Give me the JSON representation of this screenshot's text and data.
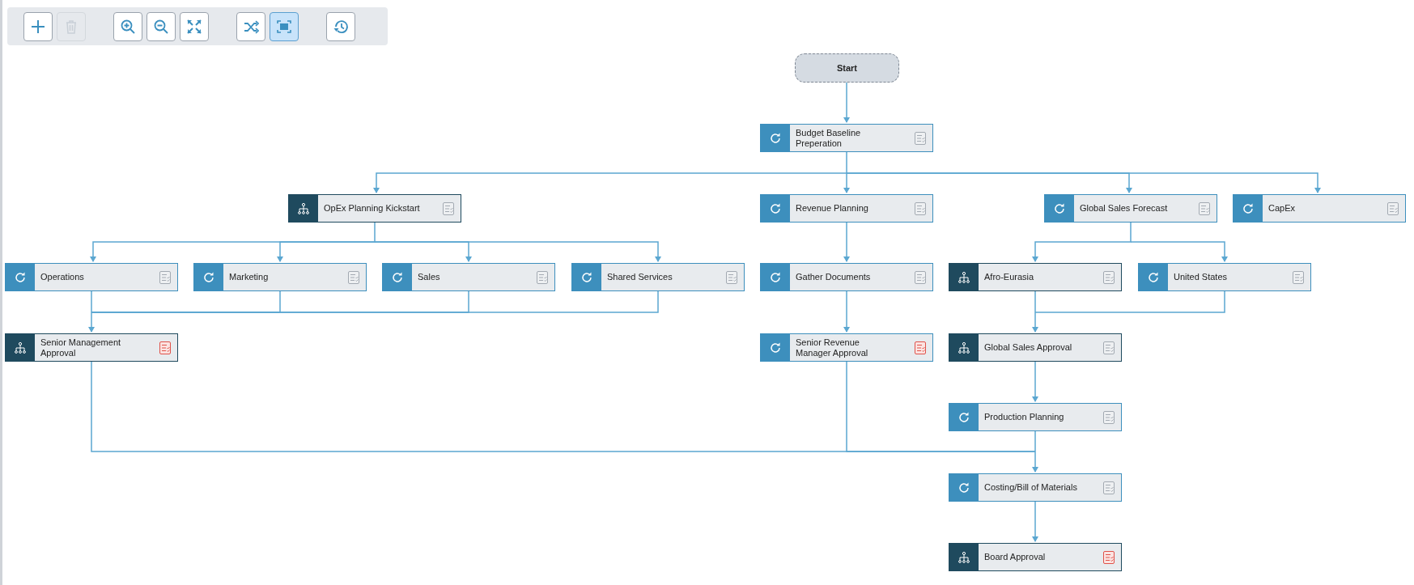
{
  "toolbar": {
    "buttons": [
      {
        "kind": "add",
        "disabled": false,
        "selected": false
      },
      {
        "kind": "delete",
        "disabled": true,
        "selected": false
      },
      {
        "kind": "zoom_in",
        "disabled": false,
        "selected": false
      },
      {
        "kind": "zoom_out",
        "disabled": false,
        "selected": false
      },
      {
        "kind": "expand",
        "disabled": false,
        "selected": false
      },
      {
        "kind": "shuffle",
        "disabled": false,
        "selected": false
      },
      {
        "kind": "fit",
        "disabled": false,
        "selected": true
      },
      {
        "kind": "history",
        "disabled": false,
        "selected": false
      }
    ]
  },
  "nodes": [
    {
      "kind": "start",
      "label": "Start"
    },
    {
      "kind": "task",
      "label": "Budget Baseline Preperation",
      "flagged": false
    },
    {
      "kind": "group",
      "label": "OpEx Planning Kickstart",
      "flagged": false
    },
    {
      "kind": "task",
      "label": "Revenue Planning",
      "flagged": false
    },
    {
      "kind": "task",
      "label": "Global Sales Forecast",
      "flagged": false
    },
    {
      "kind": "task",
      "label": "CapEx",
      "flagged": false
    },
    {
      "kind": "task",
      "label": "Operations",
      "flagged": false
    },
    {
      "kind": "task",
      "label": "Marketing",
      "flagged": false
    },
    {
      "kind": "task",
      "label": "Sales",
      "flagged": false
    },
    {
      "kind": "task",
      "label": "Shared Services",
      "flagged": false
    },
    {
      "kind": "task",
      "label": "Gather Documents",
      "flagged": false
    },
    {
      "kind": "group",
      "label": "Afro-Eurasia",
      "flagged": false
    },
    {
      "kind": "task",
      "label": "United States",
      "flagged": false
    },
    {
      "kind": "group",
      "label": "Senior Management Approval",
      "flagged": true
    },
    {
      "kind": "task",
      "label": "Senior Revenue Manager Approval",
      "flagged": true
    },
    {
      "kind": "group",
      "label": "Global Sales Approval",
      "flagged": false
    },
    {
      "kind": "task",
      "label": "Production Planning",
      "flagged": false
    },
    {
      "kind": "task",
      "label": "Costing/Bill of Materials",
      "flagged": false
    },
    {
      "kind": "group",
      "label": "Board Approval",
      "flagged": true
    }
  ]
}
